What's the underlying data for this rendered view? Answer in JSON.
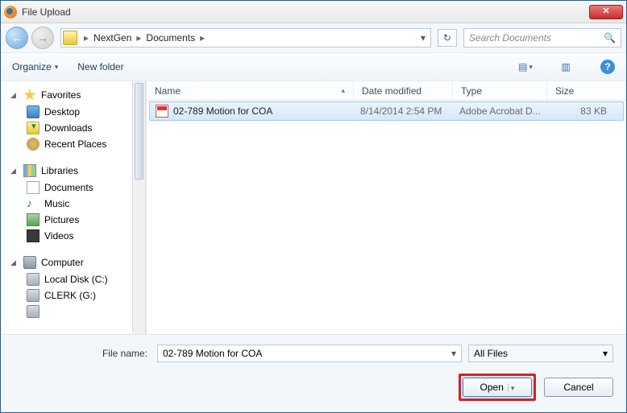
{
  "window": {
    "title": "File Upload",
    "close_glyph": "✕"
  },
  "nav": {
    "back_glyph": "←",
    "fwd_glyph": "→",
    "crumbs": [
      "NextGen",
      "Documents"
    ],
    "crumb_sep": "▸",
    "dropdown_glyph": "▾",
    "refresh_glyph": "↻"
  },
  "search": {
    "placeholder": "Search Documents",
    "mag_glyph": "🔍"
  },
  "toolbar": {
    "organize": "Organize",
    "organize_arrow": "▾",
    "newfolder": "New folder",
    "view_glyph": "▤",
    "view_arrow": "▾",
    "preview_glyph": "▥",
    "help_glyph": "?"
  },
  "sidebar": {
    "favorites": "Favorites",
    "desktop": "Desktop",
    "downloads": "Downloads",
    "recent": "Recent Places",
    "libraries": "Libraries",
    "documents": "Documents",
    "music": "Music",
    "music_glyph": "♪",
    "pictures": "Pictures",
    "videos": "Videos",
    "computer": "Computer",
    "localdisk": "Local Disk (C:)",
    "clerk": "CLERK (G:)",
    "tri_open": "◢",
    "tri_closed": "▷"
  },
  "columns": {
    "name": "Name",
    "date": "Date modified",
    "type": "Type",
    "size": "Size",
    "sort_glyph": "▴"
  },
  "files": [
    {
      "name": "02-789 Motion for COA",
      "date": "8/14/2014 2:54 PM",
      "type": "Adobe Acrobat D...",
      "size": "83 KB",
      "selected": true
    }
  ],
  "bottom": {
    "filename_label": "File name:",
    "filename_value": "02-789 Motion for COA",
    "filter_label": "All Files",
    "open": "Open",
    "cancel": "Cancel",
    "dd_glyph": "▾",
    "split_glyph": "▾"
  }
}
